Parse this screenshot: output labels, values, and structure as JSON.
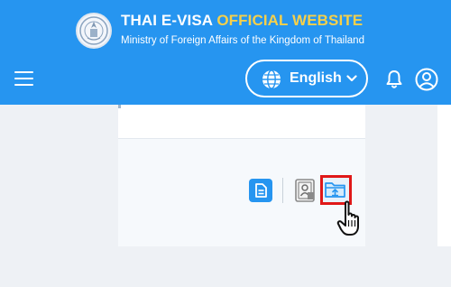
{
  "header": {
    "title_main": "THAI E-VISA ",
    "title_accent": "OFFICIAL WEBSITE",
    "subtitle": "Ministry of Foreign Affairs of the Kingdom of Thailand"
  },
  "nav": {
    "language": "English"
  },
  "icons": {
    "menu": "menu-icon",
    "globe": "globe-icon",
    "chevron": "chevron-down-icon",
    "bell": "bell-icon",
    "user": "user-icon",
    "document": "document-icon",
    "passport": "passport-icon",
    "folder": "folder-upload-icon",
    "cursor": "hand-cursor-icon"
  },
  "colors": {
    "header_bg": "#2695f0",
    "accent": "#f6d04a",
    "highlight": "#e01818"
  }
}
